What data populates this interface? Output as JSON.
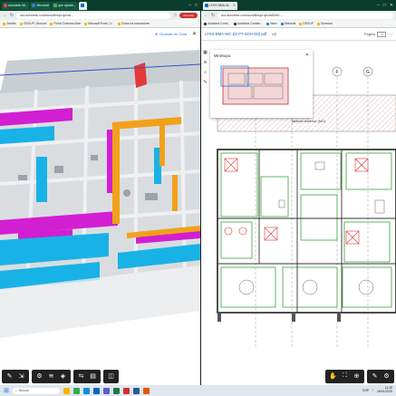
{
  "left_window": {
    "tabs": [
      {
        "label": "Autodesk Mi...",
        "active": false
      },
      {
        "label": "Microsoft",
        "active": false
      },
      {
        "label": "que apunte...",
        "active": false
      },
      {
        "label": "",
        "active": true
      }
    ],
    "url": "acc.autodesk.com/docs/files/projects/...",
    "profile": "Retomar",
    "bookmarks": [
      "Gestión",
      "GROUP | Brotond",
      "Portal Guimosa Mole",
      "Microsoft Excel | V...",
      "Todos los marcadores"
    ],
    "viewer": {
      "save_label": "Guardar en Guia",
      "close_icon": "✕"
    },
    "toolbar": {
      "icons": [
        "pencil-icon",
        "measure-icon",
        "settings-icon",
        "layers-icon",
        "model-icon",
        "share-icon",
        "properties-icon",
        "cube-icon"
      ]
    }
  },
  "right_window": {
    "tabs": [
      {
        "label": "LFKS-BMA-W...",
        "active": true
      }
    ],
    "url": "acc.autodesk.com/docs/files/projects/83df1...",
    "bookmarks": [
      "Autodesk Consl...",
      "Autodesk Constru...",
      "Inbox",
      "Webmail",
      "GROUP",
      "Guimosa"
    ],
    "pdf": {
      "title": "LFKS-BMA-WC-ZZ-PT-SOH-002.pdf",
      "version": "V2",
      "page_label": "Página",
      "page_value": "1"
    },
    "minimap": {
      "title": "Minimapa"
    },
    "drawing": {
      "grid_labels": [
        "D",
        "E",
        "F",
        "G"
      ],
      "note": "tabicón exterior (NO)"
    }
  },
  "taskbar": {
    "search_placeholder": "Buscar",
    "time": "11:25",
    "date": "16/01/2025",
    "lang": "ESP"
  },
  "colors": {
    "magenta": "#d21fd2",
    "cyan": "#19b2e6",
    "orange": "#f2a119",
    "browser_tabbar": "#0b3d2c"
  }
}
